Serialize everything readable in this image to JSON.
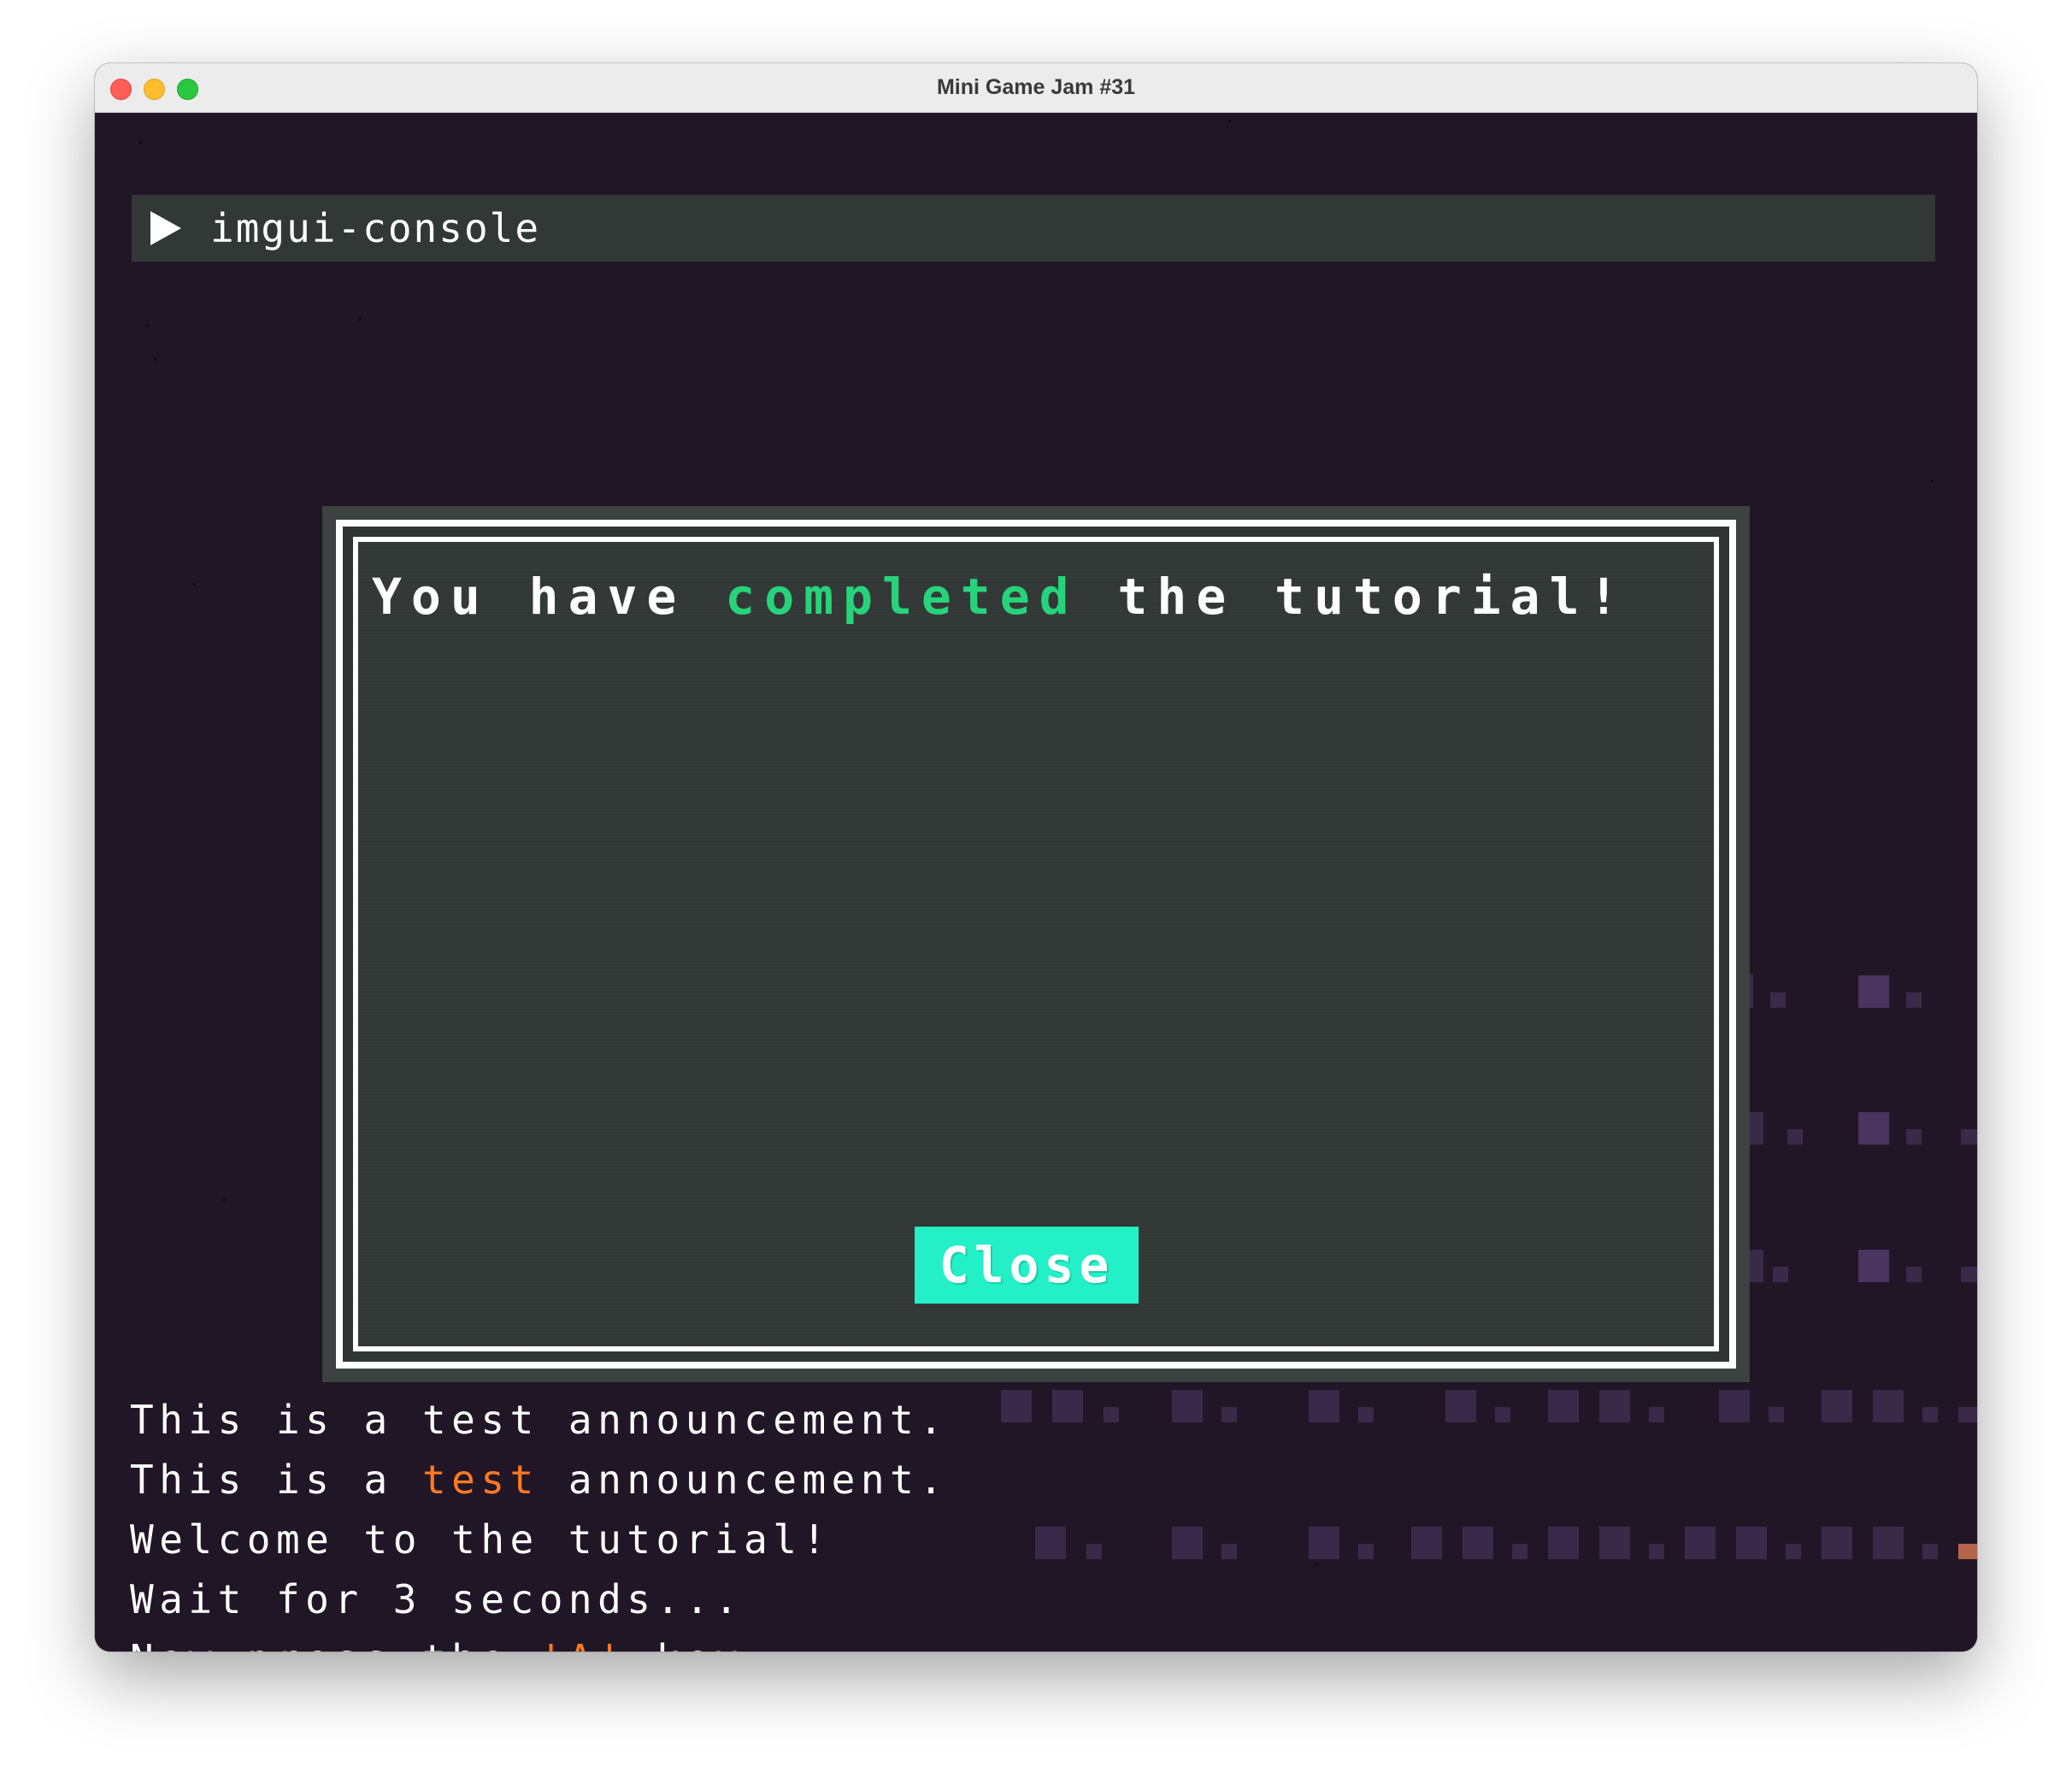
{
  "window": {
    "title": "Mini Game Jam #31"
  },
  "console": {
    "label": "imgui-console",
    "icon": "play-icon"
  },
  "popup": {
    "message_before": "You have ",
    "message_highlight": "completed",
    "message_after": " the tutorial!",
    "highlight_color": "#27d37a",
    "close_label": "Close",
    "close_color": "#23f0c7"
  },
  "log": {
    "lines": [
      {
        "before": "This is a test announcement.",
        "highlight": "",
        "after": ""
      },
      {
        "before": "This is a ",
        "highlight": "test",
        "after": " announcement."
      },
      {
        "before": "Welcome to the tutorial!",
        "highlight": "",
        "after": ""
      },
      {
        "before": "Wait for 3 seconds...",
        "highlight": "",
        "after": ""
      },
      {
        "before": "Now press the ",
        "highlight": "'A'",
        "after": " key."
      }
    ],
    "highlight_color": "#ff7a22"
  },
  "colors": {
    "background": "#211626",
    "panel": "#323836",
    "text": "#ffffff"
  }
}
